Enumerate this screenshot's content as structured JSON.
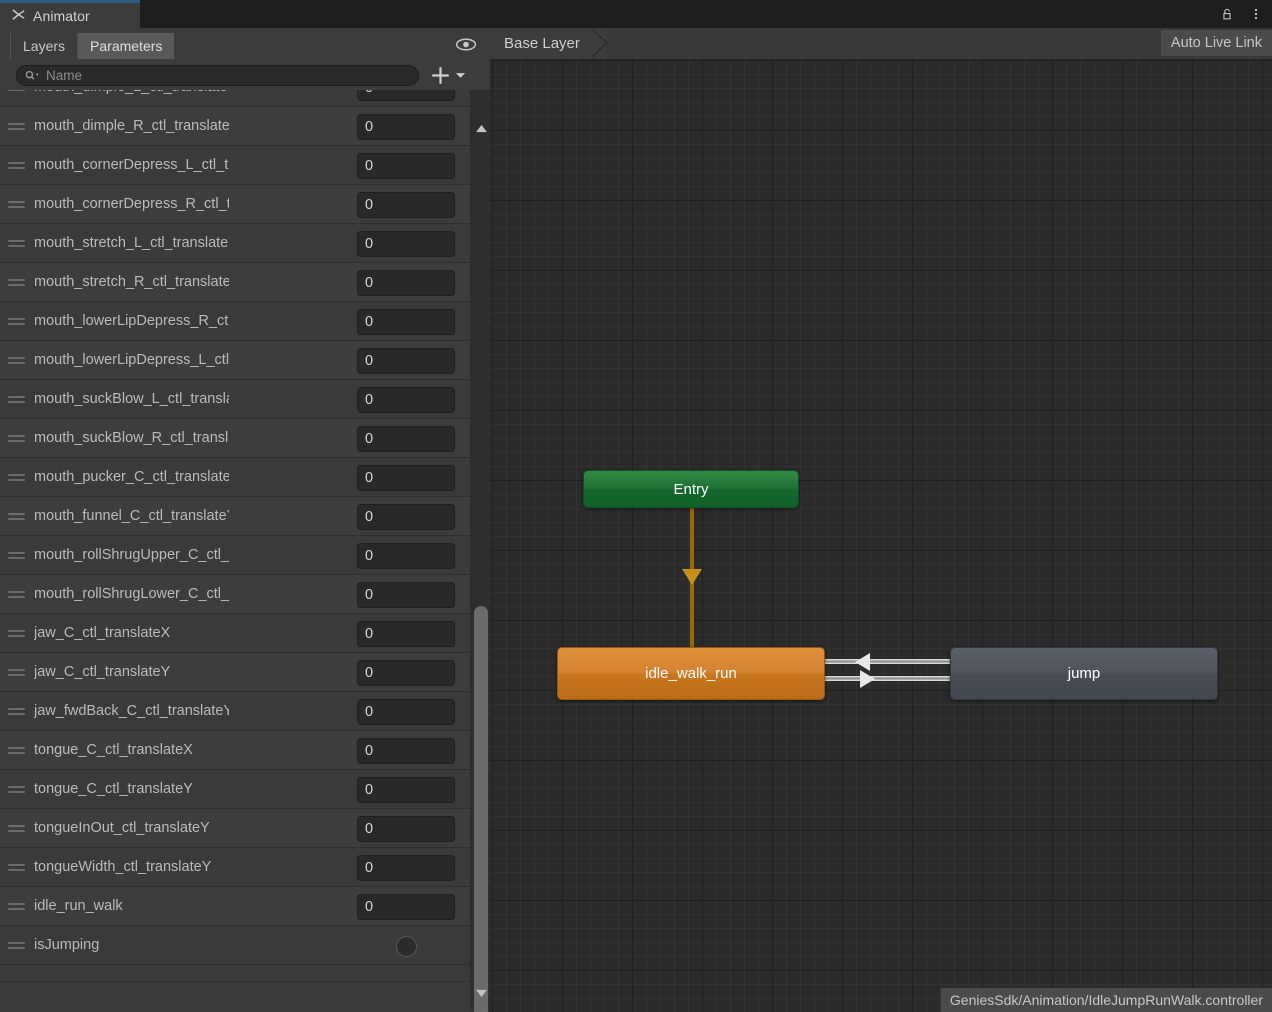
{
  "window": {
    "tab_title": "Animator",
    "tab_icon": "animator-icon",
    "lock_icon": "unlocked-padlock-icon",
    "menu_icon": "kebab-menu-icon"
  },
  "left_panel": {
    "tabs": [
      {
        "label": "Layers",
        "active": false
      },
      {
        "label": "Parameters",
        "active": true
      }
    ],
    "visibility_icon": "eye-icon",
    "search": {
      "placeholder": "Name",
      "value": "",
      "icon": "search-icon"
    },
    "add_button": {
      "label": "+",
      "dropdown_icon": "chevron-down-icon"
    },
    "scrollbar": {
      "up_icon": "triangle-up-icon",
      "down_icon": "triangle-down-icon"
    },
    "parameters": [
      {
        "name": "mouth_dimple_L_ctl_translateY",
        "value": "0",
        "type": "float"
      },
      {
        "name": "mouth_dimple_R_ctl_translateY",
        "value": "0",
        "type": "float"
      },
      {
        "name": "mouth_cornerDepress_L_ctl_translateY",
        "value": "0",
        "type": "float"
      },
      {
        "name": "mouth_cornerDepress_R_ctl_translateY",
        "value": "0",
        "type": "float"
      },
      {
        "name": "mouth_stretch_L_ctl_translateY",
        "value": "0",
        "type": "float"
      },
      {
        "name": "mouth_stretch_R_ctl_translateY",
        "value": "0",
        "type": "float"
      },
      {
        "name": "mouth_lowerLipDepress_R_ctl_translateY",
        "value": "0",
        "type": "float"
      },
      {
        "name": "mouth_lowerLipDepress_L_ctl_translateY",
        "value": "0",
        "type": "float"
      },
      {
        "name": "mouth_suckBlow_L_ctl_translateY",
        "value": "0",
        "type": "float"
      },
      {
        "name": "mouth_suckBlow_R_ctl_translateY",
        "value": "0",
        "type": "float"
      },
      {
        "name": "mouth_pucker_C_ctl_translateY",
        "value": "0",
        "type": "float"
      },
      {
        "name": "mouth_funnel_C_ctl_translateY",
        "value": "0",
        "type": "float"
      },
      {
        "name": "mouth_rollShrugUpper_C_ctl_translateY",
        "value": "0",
        "type": "float"
      },
      {
        "name": "mouth_rollShrugLower_C_ctl_translateY",
        "value": "0",
        "type": "float"
      },
      {
        "name": "jaw_C_ctl_translateX",
        "value": "0",
        "type": "float"
      },
      {
        "name": "jaw_C_ctl_translateY",
        "value": "0",
        "type": "float"
      },
      {
        "name": "jaw_fwdBack_C_ctl_translateY",
        "value": "0",
        "type": "float"
      },
      {
        "name": "tongue_C_ctl_translateX",
        "value": "0",
        "type": "float"
      },
      {
        "name": "tongue_C_ctl_translateY",
        "value": "0",
        "type": "float"
      },
      {
        "name": "tongueInOut_ctl_translateY",
        "value": "0",
        "type": "float"
      },
      {
        "name": "tongueWidth_ctl_translateY",
        "value": "0",
        "type": "float"
      },
      {
        "name": "idle_run_walk",
        "value": "0",
        "type": "float"
      },
      {
        "name": "isJumping",
        "value": "",
        "type": "bool"
      }
    ]
  },
  "graph": {
    "breadcrumb": "Base Layer",
    "auto_live_link": "Auto Live Link",
    "nodes": [
      {
        "id": "entry",
        "label": "Entry",
        "kind": "entry",
        "color": "#1f7034"
      },
      {
        "id": "idle",
        "label": "idle_walk_run",
        "kind": "default-state",
        "color": "#d4822f"
      },
      {
        "id": "jump",
        "label": "jump",
        "kind": "state",
        "color": "#4f545c"
      }
    ],
    "transitions": [
      {
        "from": "entry",
        "to": "idle",
        "color": "#c79018"
      },
      {
        "from": "jump",
        "to": "idle",
        "color": "#d8d8d8"
      },
      {
        "from": "idle",
        "to": "jump",
        "color": "#d8d8d8"
      }
    ],
    "status_path": "GeniesSdk/Animation/IdleJumpRunWalk.controller"
  }
}
